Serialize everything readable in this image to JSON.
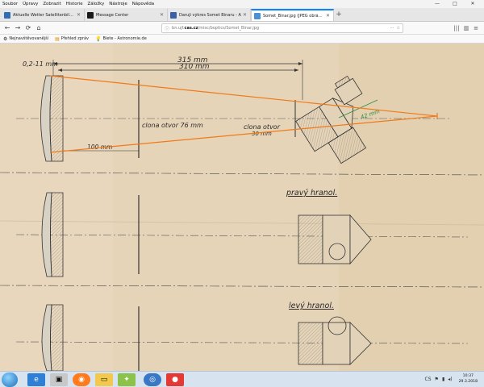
{
  "menubar": {
    "items": [
      "Soubor",
      "Úpravy",
      "Zobrazit",
      "Historie",
      "Záložky",
      "Nástroje",
      "Nápověda"
    ]
  },
  "window_controls": {
    "minimize": "—",
    "maximize": "□",
    "close": "✕"
  },
  "tabs": [
    {
      "title": "Aktuelle Wetter Satellitenbilder",
      "icon": "weather-icon",
      "color": "#2f6db5"
    },
    {
      "title": "Message Center",
      "icon": "message-icon",
      "color": "#1a1a1a"
    },
    {
      "title": "Daruji výkres Somet Binaru - A",
      "icon": "forum-icon",
      "color": "#3b5ea8"
    },
    {
      "title": "Somet_Binar.jpg (JPEG obrázek)",
      "icon": "image-icon",
      "color": "#4a90d9",
      "active": true
    }
  ],
  "navbar": {
    "back": "←",
    "forward": "→",
    "reload": "⟳",
    "home": "⌂",
    "url_prefix": "bn.ujf.",
    "url_domain": "cas.cz",
    "url_path": "/misc/boptics/Somet_Binar.jpg",
    "menu_dots": "⋯",
    "bookmark_star": "☆",
    "library": "|||",
    "sidebar": "▥",
    "hamburger": "≡"
  },
  "bookmarks": [
    {
      "label": "Nejnavštěvovanější",
      "icon": "gear-icon"
    },
    {
      "label": "Přehled zpráv",
      "icon": "rss-icon"
    },
    {
      "label": "Biete - Astronomie.de",
      "icon": "bulb-icon"
    }
  ],
  "drawing": {
    "dim_02_11": "0,2-11 mm",
    "dim_315": "315 mm",
    "dim_310": "310 mm",
    "aperture_stop": "clona otvor 76 mm",
    "field_stop": "clona otvor",
    "field_stop_dim": "30 mm",
    "dim_100": "100 mm",
    "right_prism": "pravý hranol.",
    "left_prism": "levý hranol.",
    "green_annotation": "42 mm"
  },
  "taskbar": {
    "apps": [
      "explorer",
      "filemanager",
      "media",
      "firefox",
      "photos",
      "gallery",
      "network",
      "recorder"
    ],
    "tray_lang": "CS",
    "time": "10:37",
    "date": "29.3.2018"
  }
}
